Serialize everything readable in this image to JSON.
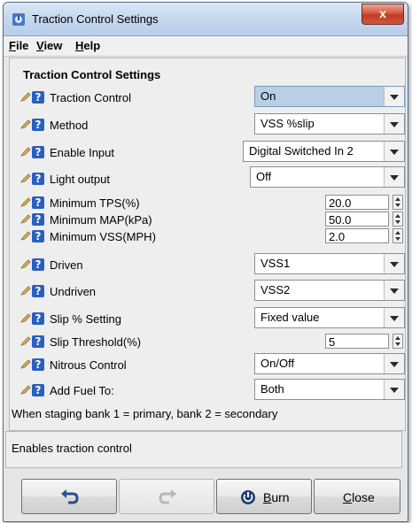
{
  "window": {
    "title": "Traction Control Settings",
    "close_glyph": "x"
  },
  "menu": {
    "file": {
      "mnemonic": "F",
      "rest": "ile"
    },
    "view": {
      "mnemonic": "V",
      "rest": "iew"
    },
    "help": {
      "mnemonic": "H",
      "rest": "elp"
    }
  },
  "panel": {
    "title": "Traction Control Settings",
    "rows": [
      {
        "label": "Traction Control",
        "value": "On"
      },
      {
        "label": "Method",
        "value": "VSS %slip"
      },
      {
        "label": "Enable Input",
        "value": "Digital Switched In 2"
      },
      {
        "label": "Light output",
        "value": "Off"
      },
      {
        "label": "Minimum TPS(%)",
        "value": "20.0"
      },
      {
        "label": "Minimum MAP(kPa)",
        "value": "50.0"
      },
      {
        "label": "Minimum VSS(MPH)",
        "value": "2.0"
      },
      {
        "label": "Driven",
        "value": "VSS1"
      },
      {
        "label": "Undriven",
        "value": "VSS2"
      },
      {
        "label": "Slip % Setting",
        "value": "Fixed value"
      },
      {
        "label": "Slip Threshold(%)",
        "value": "5"
      },
      {
        "label": "Nitrous Control",
        "value": "On/Off"
      },
      {
        "label": "Add Fuel To:",
        "value": "Both"
      }
    ],
    "note": "When staging bank 1 = primary, bank 2 = secondary"
  },
  "description": "Enables traction control",
  "buttons": {
    "undo_icon": "undo-icon",
    "redo_icon": "redo-icon",
    "burn": {
      "mnemonic": "B",
      "rest": "urn"
    },
    "close": {
      "mnemonic": "C",
      "rest": "lose"
    }
  },
  "colors": {
    "help_icon": "#2a5fc0",
    "active_combo": "#b8cfe6",
    "close_button": "#c23a22"
  }
}
